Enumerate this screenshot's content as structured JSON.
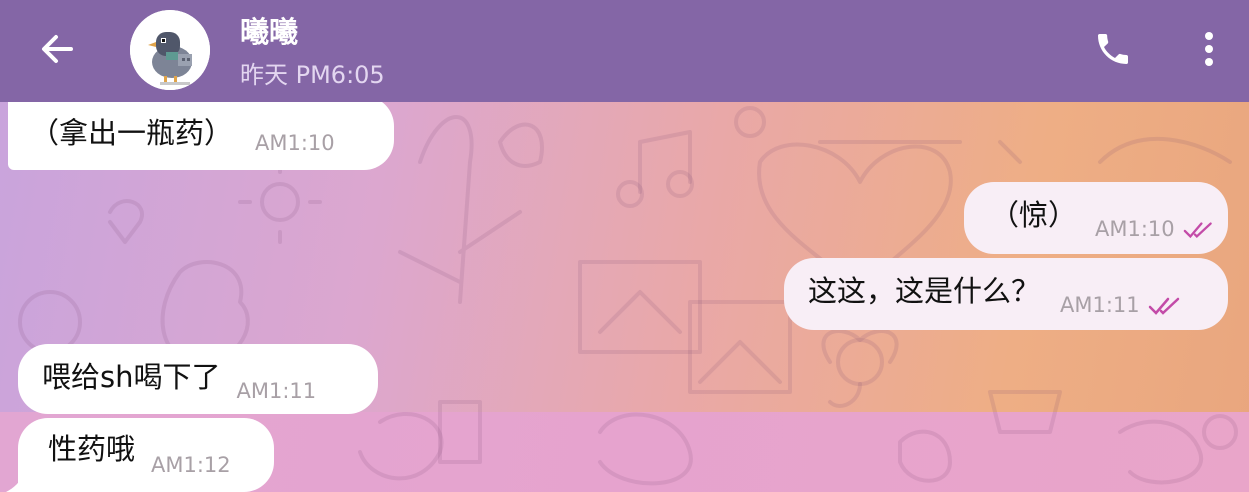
{
  "header": {
    "contact_name": "曦曦",
    "last_seen": "昨天 PM6:05"
  },
  "icons": {
    "back": "back-arrow-icon",
    "call": "phone-icon",
    "more": "more-vertical-icon"
  },
  "colors": {
    "header_bg": "#8466a6",
    "read_ticks": "#c34ba8"
  },
  "messages": [
    {
      "direction": "incoming",
      "text": "（拿出一瓶药）",
      "time": "AM1:10"
    },
    {
      "direction": "outgoing",
      "text": "（惊）",
      "time": "AM1:10",
      "read": true
    },
    {
      "direction": "outgoing",
      "text": "这这，这是什么？",
      "time": "AM1:11",
      "read": true
    },
    {
      "direction": "incoming",
      "text": "喂给sh喝下了",
      "time": "AM1:11"
    },
    {
      "direction": "incoming",
      "text": "性药哦",
      "time": "AM1:12"
    }
  ]
}
